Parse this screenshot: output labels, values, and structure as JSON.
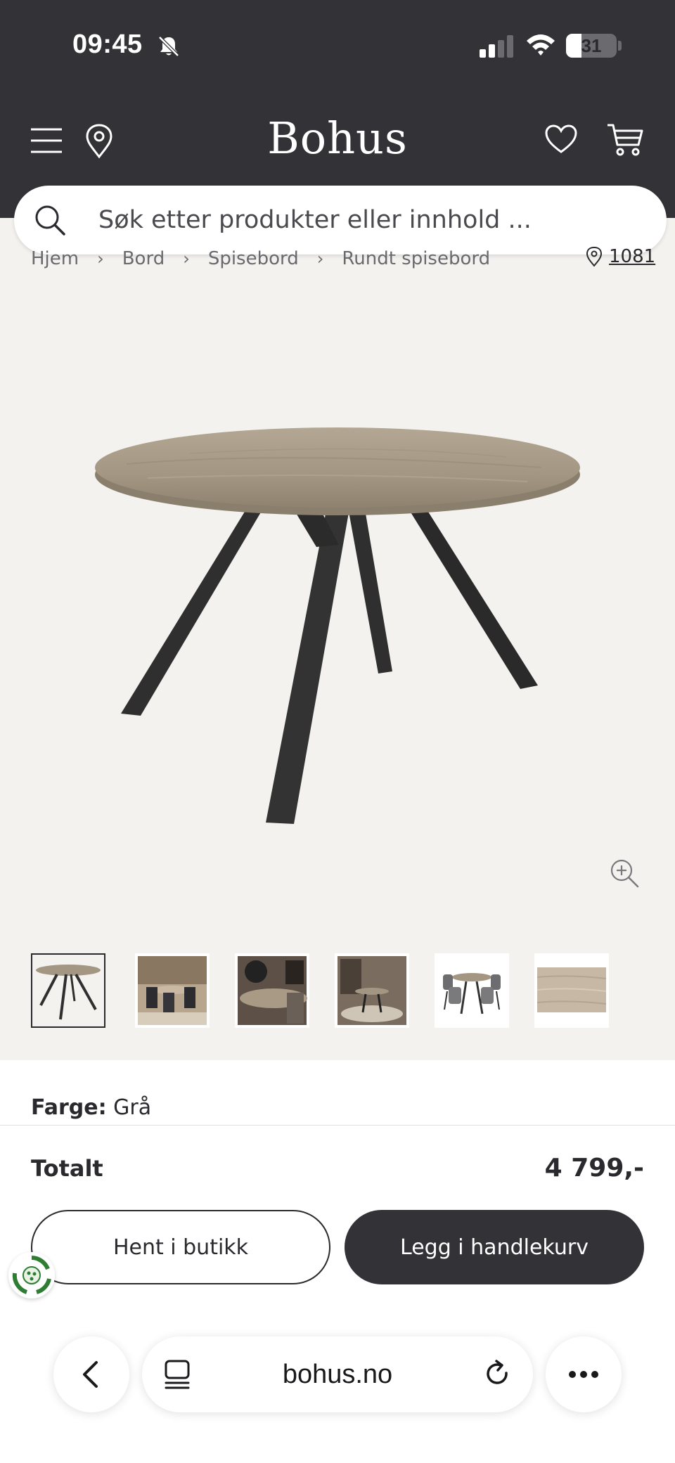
{
  "status_bar": {
    "time": "09:45",
    "battery": "31",
    "battery_level": 0.31
  },
  "header": {
    "logo": "Bohus",
    "icons": [
      "menu-icon",
      "location-pin-icon",
      "heart-icon",
      "cart-icon"
    ]
  },
  "search": {
    "placeholder": "Søk etter produkter eller innhold ..."
  },
  "breadcrumb": {
    "items": [
      "Hjem",
      "Bord",
      "Spisebord",
      "Rundt spisebord"
    ],
    "separator": "›",
    "store": "1081"
  },
  "product": {
    "thumbnail_count": 6,
    "selected_thumbnail": 0
  },
  "details": {
    "color_label": "Farge:",
    "color_value": "Grå"
  },
  "footer": {
    "total_label": "Totalt",
    "total_price": "4 799,-",
    "pickup_button": "Hent i butikk",
    "cart_button": "Legg i handlekurv"
  },
  "browser": {
    "url": "bohus.no"
  },
  "colors": {
    "header_bg": "#333237",
    "page_bg": "#f4f2ef",
    "primary_button": "#333237",
    "tabletop": "#a39683",
    "table_legs": "#2f2f2f"
  }
}
